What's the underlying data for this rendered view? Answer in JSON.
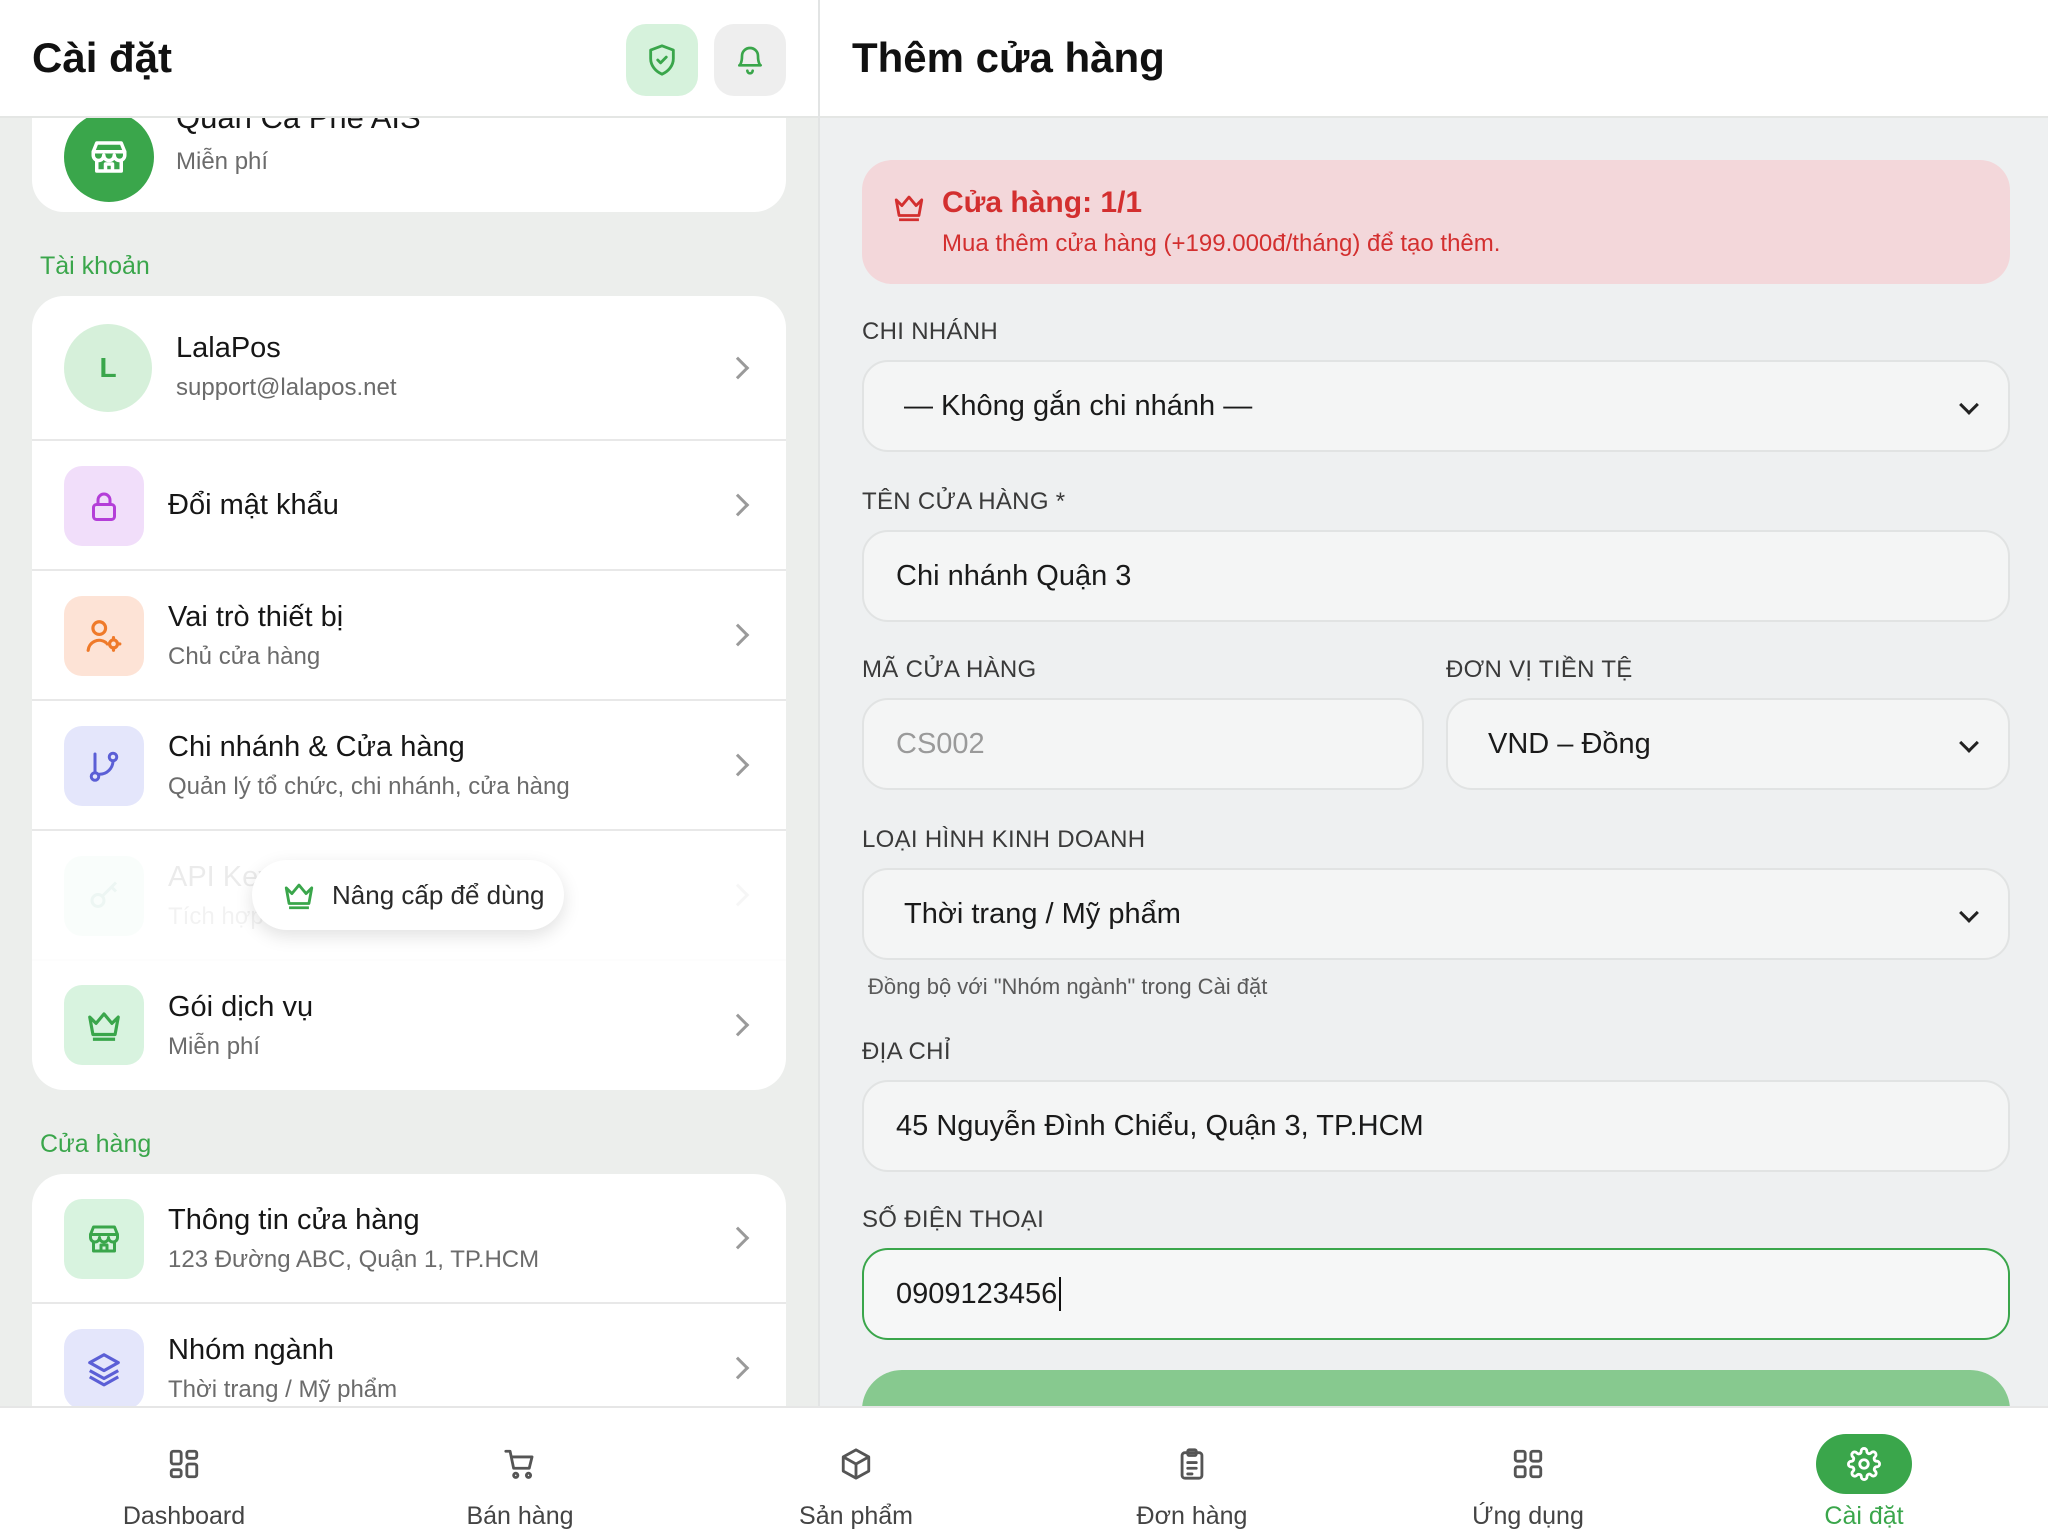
{
  "left_panel": {
    "title": "Cài đặt",
    "store_card": {
      "name": "Quán Cà Phê AIS",
      "plan": "Miễn phí"
    },
    "account_section": "Tài khoản",
    "profile": {
      "initial": "L",
      "name": "LalaPos",
      "email": "support@lalapos.net"
    },
    "items": [
      {
        "title": "Đổi mật khẩu",
        "subtitle": ""
      },
      {
        "title": "Vai trò thiết bị",
        "subtitle": "Chủ cửa hàng"
      },
      {
        "title": "Chi nhánh & Cửa hàng",
        "subtitle": "Quản lý tổ chức, chi nhánh, cửa hàng"
      },
      {
        "title": "API Key",
        "subtitle": "Tích hợp"
      },
      {
        "title": "Gói dịch vụ",
        "subtitle": "Miễn phí"
      }
    ],
    "upgrade_label": "Nâng cấp để dùng",
    "store_section": "Cửa hàng",
    "store_items": [
      {
        "title": "Thông tin cửa hàng",
        "subtitle": "123 Đường ABC, Quận 1, TP.HCM"
      },
      {
        "title": "Nhóm ngành",
        "subtitle": "Thời trang / Mỹ phẩm"
      }
    ]
  },
  "right_panel": {
    "title": "Thêm cửa hàng",
    "alert": {
      "title": "Cửa hàng: 1/1",
      "message": "Mua thêm cửa hàng (+199.000đ/tháng) để tạo thêm."
    },
    "branch": {
      "label": "CHI NHÁNH",
      "value": "— Không gắn chi nhánh —"
    },
    "store_name": {
      "label": "TÊN CỬA HÀNG *",
      "value": "Chi nhánh Quận 3"
    },
    "store_code": {
      "label": "MÃ CỬA HÀNG",
      "placeholder": "CS002"
    },
    "currency": {
      "label": "ĐƠN VỊ TIỀN TỆ",
      "value": "VND – Đồng"
    },
    "business_type": {
      "label": "LOẠI HÌNH KINH DOANH",
      "value": "Thời trang / Mỹ phẩm",
      "hint": "Đồng bộ với \"Nhóm ngành\" trong Cài đặt"
    },
    "address": {
      "label": "ĐỊA CHỈ",
      "value": "45 Nguyễn Đình Chiểu, Quận 3, TP.HCM"
    },
    "phone": {
      "label": "SỐ ĐIỆN THOẠI",
      "value": "0909123456"
    }
  },
  "bottom_nav": [
    {
      "label": "Dashboard",
      "icon": "grid-icon"
    },
    {
      "label": "Bán hàng",
      "icon": "cart-icon"
    },
    {
      "label": "Sản phẩm",
      "icon": "box-icon"
    },
    {
      "label": "Đơn hàng",
      "icon": "clipboard-icon"
    },
    {
      "label": "Ứng dụng",
      "icon": "apps-icon"
    },
    {
      "label": "Cài đặt",
      "icon": "gear-icon",
      "active": true
    }
  ],
  "colors": {
    "accent": "#3aa64b",
    "alert_bg": "#f3d7da",
    "alert_text": "#d32f2f"
  }
}
